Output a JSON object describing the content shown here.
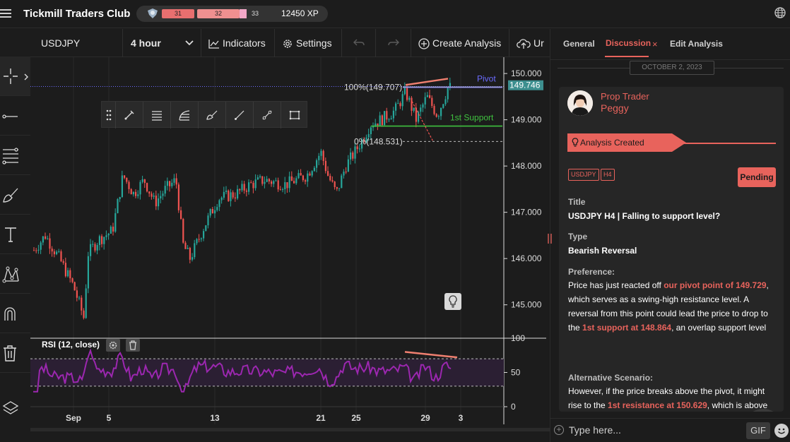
{
  "header": {
    "title": "Tickmill Traders Club",
    "xp_levels": [
      "31",
      "32",
      "33"
    ],
    "xp": "12450 XP"
  },
  "chart_toolbar": {
    "symbol": "USDJPY",
    "timeframe": "4 hour",
    "indicators": "Indicators",
    "settings": "Settings",
    "create_analysis": "Create Analysis",
    "upload": "Ur"
  },
  "chart_data": {
    "type": "candlestick",
    "x_ticks": [
      "Sep",
      "5",
      "13",
      "21",
      "25",
      "29",
      "3"
    ],
    "y_ticks": [
      "150.000",
      "149.000",
      "148.000",
      "147.000",
      "146.000",
      "145.000"
    ],
    "ylim": [
      144.4,
      150.2
    ],
    "current_price": "149.746",
    "annotations": {
      "fib_100": "100%(149.707)",
      "fib_0": "0%(148.531)",
      "pivot": "Pivot",
      "support": "1st Support"
    },
    "levels": {
      "pivot": 149.72,
      "support": 148.864,
      "fib_100": 149.707,
      "fib_0": 148.531
    },
    "rsi": {
      "label": "RSI (12, close)",
      "y_ticks": [
        "100",
        "50",
        "0"
      ],
      "upper": 70,
      "lower": 30
    }
  },
  "panel": {
    "tabs": [
      "General",
      "Discussion",
      "Edit Analysis"
    ],
    "date": "OCTOBER 2, 2023",
    "post": {
      "role": "Prop Trader",
      "user": "Peggy",
      "banner": "Analysis Created",
      "tags": [
        "USDJPY",
        "H4"
      ],
      "status": "Pending",
      "title_label": "Title",
      "title": "USDJPY H4 | Falling to support level?",
      "type_label": "Type",
      "type": "Bearish Reversal",
      "pref_label": "Preference:",
      "pref": [
        "Price has just reacted off ",
        "our pivot point of 149.729",
        ", which serves as a swing-high resistance level. A reversal from this point could lead the price to drop to the ",
        "1st support at 148.864",
        ", an overlap support level"
      ],
      "alt_label": "Alternative Scenario:",
      "alt": [
        " However, if the price breaks above the pivot, it might rise to the ",
        "1st resistance at 150.629",
        ", which is above"
      ]
    },
    "composer": {
      "placeholder": "Type here...",
      "gif": "GIF"
    }
  },
  "colors": {
    "accent": "#e8635c",
    "up": "#26a69a",
    "down": "#ef5350",
    "support": "#3fc23f",
    "pivot": "#6b6bff",
    "rsi": "#9c27b0"
  }
}
